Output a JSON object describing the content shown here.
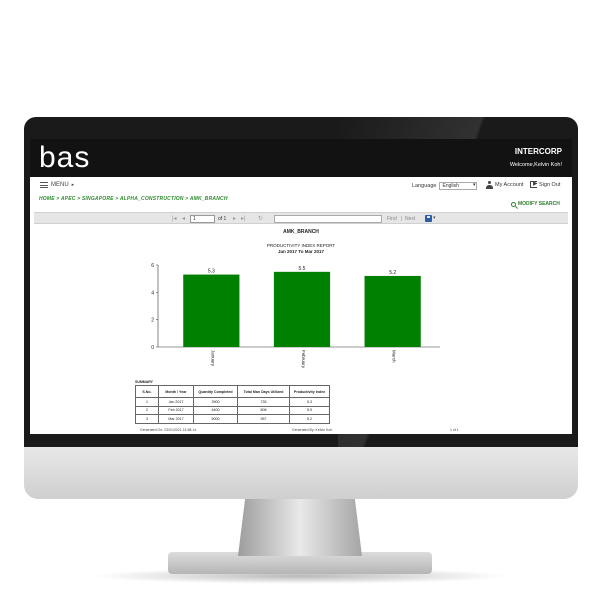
{
  "app": {
    "logo": "bas",
    "company": "INTERCORP",
    "welcome": "Welcome,Kelvin Koh!"
  },
  "nav": {
    "menu_label": "MENU",
    "language_label": "Language",
    "language_value": "English",
    "account_label": "My Account",
    "signout_label": "Sign Out",
    "breadcrumb": "HOME > APEC > SINGAPORE > ALPHA_CONSTRUCTION > AMK_BRANCH",
    "modify_search_label": "MODIFY SEARCH"
  },
  "toolbar": {
    "page_value": "1",
    "page_of": "of 1",
    "find_label": "Find",
    "separator": "|",
    "next_label": "Next"
  },
  "report": {
    "header": "AMK_BRANCH",
    "title": "PRODUCTIVITY INDEX REPORT",
    "period": "Jan 2017 To Mar 2017"
  },
  "chart_data": {
    "type": "bar",
    "categories": [
      "January",
      "February",
      "March"
    ],
    "values": [
      5.3,
      5.5,
      5.2
    ],
    "data_labels": [
      "5.3",
      "5.5",
      "5.2"
    ],
    "ylim": [
      0,
      6
    ],
    "yticks": [
      0,
      2,
      4,
      6
    ],
    "grid": false,
    "bar_color": "#008000"
  },
  "summary": {
    "label": "SUMMARY",
    "headers": [
      "S.No.",
      "Month / Year",
      "Quantity Completed",
      "Total Man Days Utilized",
      "Productivity Index"
    ],
    "rows": [
      [
        "1",
        "Jan 2017",
        "3900",
        "735",
        "5.3"
      ],
      [
        "2",
        "Feb 2017",
        "4400",
        "808",
        "5.5"
      ],
      [
        "3",
        "Mar 2017",
        "5000",
        "957",
        "5.2"
      ]
    ]
  },
  "footer": {
    "generated_on": "Generated On: 23/01/2021 14:58:14",
    "generated_by": "Generated By: Kelvin Koh",
    "page": "1 of 1"
  },
  "colors": {
    "topbar": "#121212",
    "breadcrumb": "#2e8b2e",
    "bar": "#008000"
  }
}
